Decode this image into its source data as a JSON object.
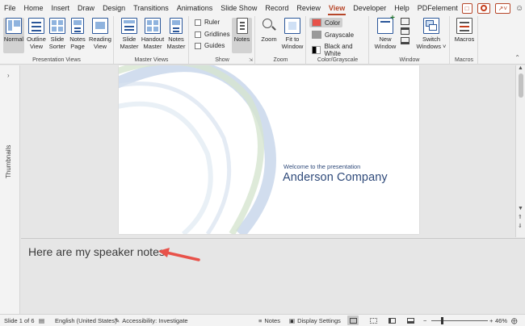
{
  "menu": {
    "tabs": [
      "File",
      "Home",
      "Insert",
      "Draw",
      "Design",
      "Transitions",
      "Animations",
      "Slide Show",
      "Record",
      "Review",
      "View",
      "Developer",
      "Help",
      "PDFelement"
    ],
    "active_tab": "View"
  },
  "ribbon": {
    "presentation_views": {
      "label": "Presentation Views",
      "buttons": [
        {
          "line1": "Normal",
          "line2": ""
        },
        {
          "line1": "Outline",
          "line2": "View"
        },
        {
          "line1": "Slide",
          "line2": "Sorter"
        },
        {
          "line1": "Notes",
          "line2": "Page"
        },
        {
          "line1": "Reading",
          "line2": "View"
        }
      ]
    },
    "master_views": {
      "label": "Master Views",
      "buttons": [
        {
          "line1": "Slide",
          "line2": "Master"
        },
        {
          "line1": "Handout",
          "line2": "Master"
        },
        {
          "line1": "Notes",
          "line2": "Master"
        }
      ]
    },
    "show": {
      "label": "Show",
      "checkboxes": [
        "Ruler",
        "Gridlines",
        "Guides"
      ],
      "notes_button": "Notes"
    },
    "zoom": {
      "label": "Zoom",
      "zoom_button": "Zoom",
      "fit_line1": "Fit to",
      "fit_line2": "Window"
    },
    "color_grayscale": {
      "label": "Color/Grayscale",
      "options": [
        "Color",
        "Grayscale",
        "Black and White"
      ]
    },
    "window": {
      "label": "Window",
      "new_line1": "New",
      "new_line2": "Window",
      "switch_line1": "Switch",
      "switch_line2": "Windows ˅"
    },
    "macros": {
      "label": "Macros",
      "button": "Macros"
    }
  },
  "thumbnails": {
    "label": "Thumbnails"
  },
  "slide": {
    "subtitle": "Welcome to the presentation",
    "title": "Anderson Company"
  },
  "notes": {
    "text": "Here are my speaker notes."
  },
  "status": {
    "slide": "Slide 1 of 6",
    "language": "English (United States)",
    "accessibility": "Accessibility: Investigate",
    "notes": "Notes",
    "display": "Display Settings",
    "zoom": "46%"
  },
  "colors": {
    "accent": "#b7472a",
    "slide_text": "#2f4a7a",
    "arrow": "#e8524a"
  }
}
